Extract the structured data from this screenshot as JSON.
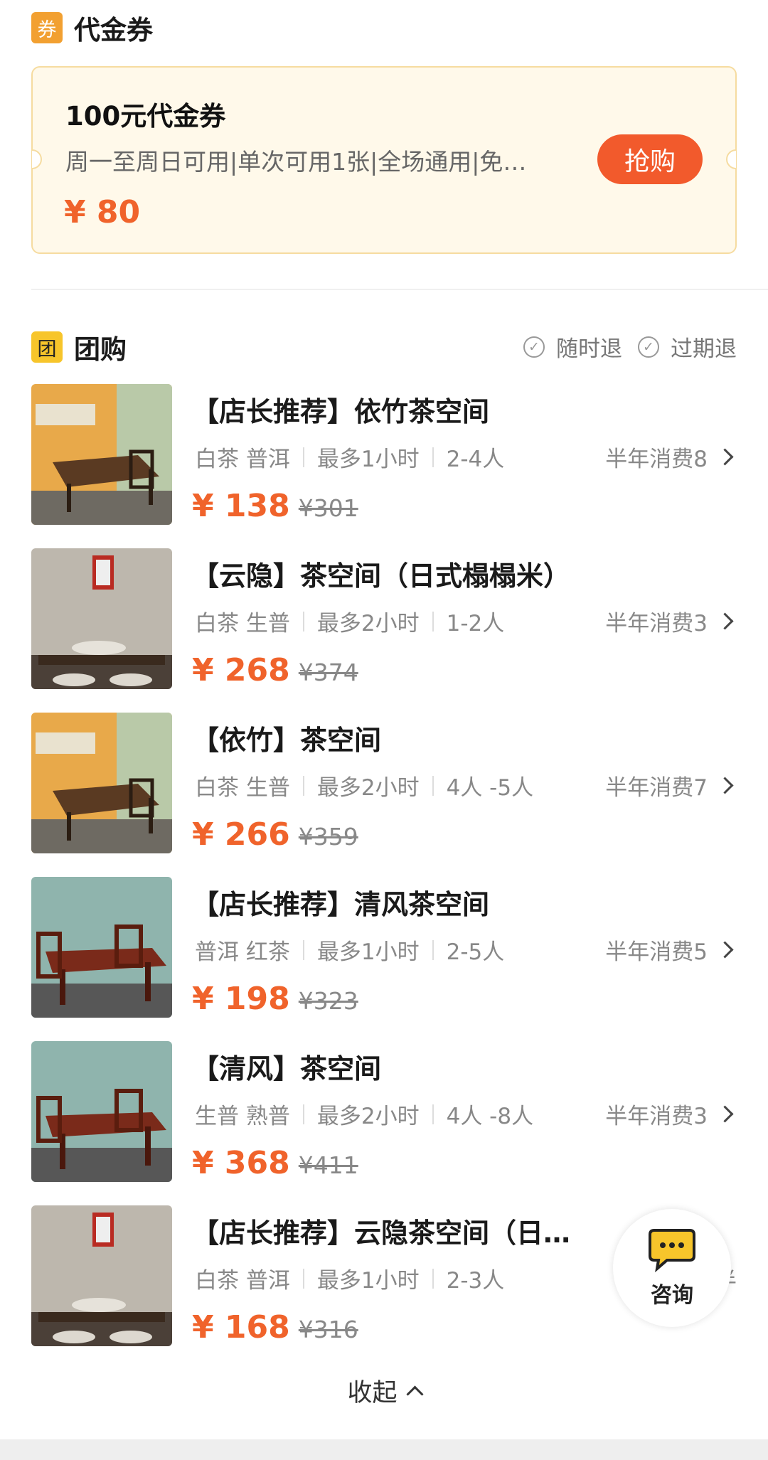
{
  "voucher_section": {
    "icon_char": "券",
    "title": "代金券",
    "card": {
      "title": "100元代金券",
      "desc": "周一至周日可用|单次可用1张|全场通用|免…",
      "price": "¥ 80",
      "buy_label": "抢购"
    }
  },
  "group_section": {
    "icon_char": "团",
    "title": "团购",
    "policies": [
      "随时退",
      "过期退"
    ],
    "deals": [
      {
        "title": "【店长推荐】依竹茶空间",
        "tea": "白茶 普洱",
        "duration": "最多1小时",
        "people": "2-4人",
        "sales": "半年消费8",
        "price": "¥ 138",
        "old_price": "¥301",
        "image": "yellow-room"
      },
      {
        "title": "【云隐】茶空间（日式榻榻米）",
        "tea": "白茶 生普",
        "duration": "最多2小时",
        "people": "1-2人",
        "sales": "半年消费3",
        "price": "¥ 268",
        "old_price": "¥374",
        "image": "tatami-room"
      },
      {
        "title": "【依竹】茶空间",
        "tea": "白茶 生普",
        "duration": "最多2小时",
        "people": "4人 -5人",
        "sales": "半年消费7",
        "price": "¥ 266",
        "old_price": "¥359",
        "image": "yellow-room"
      },
      {
        "title": "【店长推荐】清风茶空间",
        "tea": "普洱 红茶",
        "duration": "最多1小时",
        "people": "2-5人",
        "sales": "半年消费5",
        "price": "¥ 198",
        "old_price": "¥323",
        "image": "green-room"
      },
      {
        "title": "【清风】茶空间",
        "tea": "生普 熟普",
        "duration": "最多2小时",
        "people": "4人 -8人",
        "sales": "半年消费3",
        "price": "¥ 368",
        "old_price": "¥411",
        "image": "green-room"
      },
      {
        "title": "【店长推荐】云隐茶空间（日…",
        "tea": "白茶 普洱",
        "duration": "最多1小时",
        "people": "2-3人",
        "sales": "半",
        "price": "¥ 168",
        "old_price": "¥316",
        "image": "tatami-room"
      }
    ]
  },
  "consult": {
    "label": "咨询",
    "icon": "chat-bubble-icon"
  },
  "collapse_label": "收起",
  "colors": {
    "accent": "#f0632b",
    "voucher_bg": "#fff9ea",
    "voucher_border": "#f6dca0",
    "buy_button": "#f25a2c"
  }
}
